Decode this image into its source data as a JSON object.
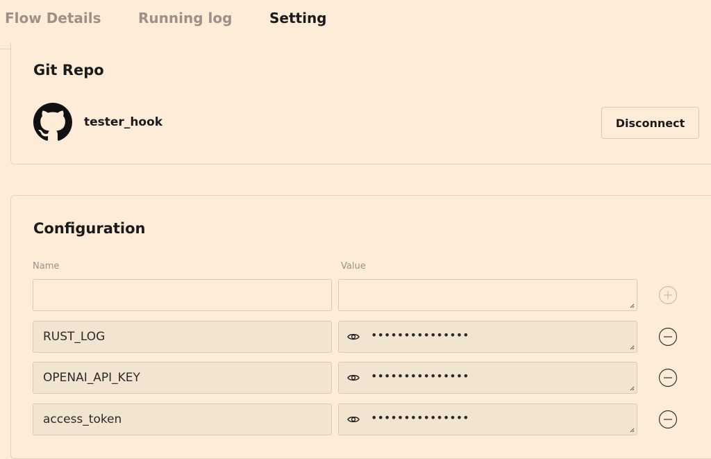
{
  "tabs": [
    {
      "label": "Flow Details"
    },
    {
      "label": "Running log"
    },
    {
      "label": "Setting"
    }
  ],
  "git_repo": {
    "title": "Git Repo",
    "repo_name": "tester_hook",
    "avatar_icon": "github-icon",
    "disconnect_label": "Disconnect"
  },
  "configuration": {
    "title": "Configuration",
    "name_header": "Name",
    "value_header": "Value",
    "new_row": {
      "name": "",
      "value": ""
    },
    "rows": [
      {
        "name": "RUST_LOG",
        "value_masked": "•••••••••••••••"
      },
      {
        "name": "OPENAI_API_KEY",
        "value_masked": "•••••••••••••••"
      },
      {
        "name": "access_token",
        "value_masked": "•••••••••••••••"
      }
    ]
  },
  "colors": {
    "background": "#fcecd8",
    "accent": "#9b59d0",
    "filled_field": "#f1e4d0"
  }
}
